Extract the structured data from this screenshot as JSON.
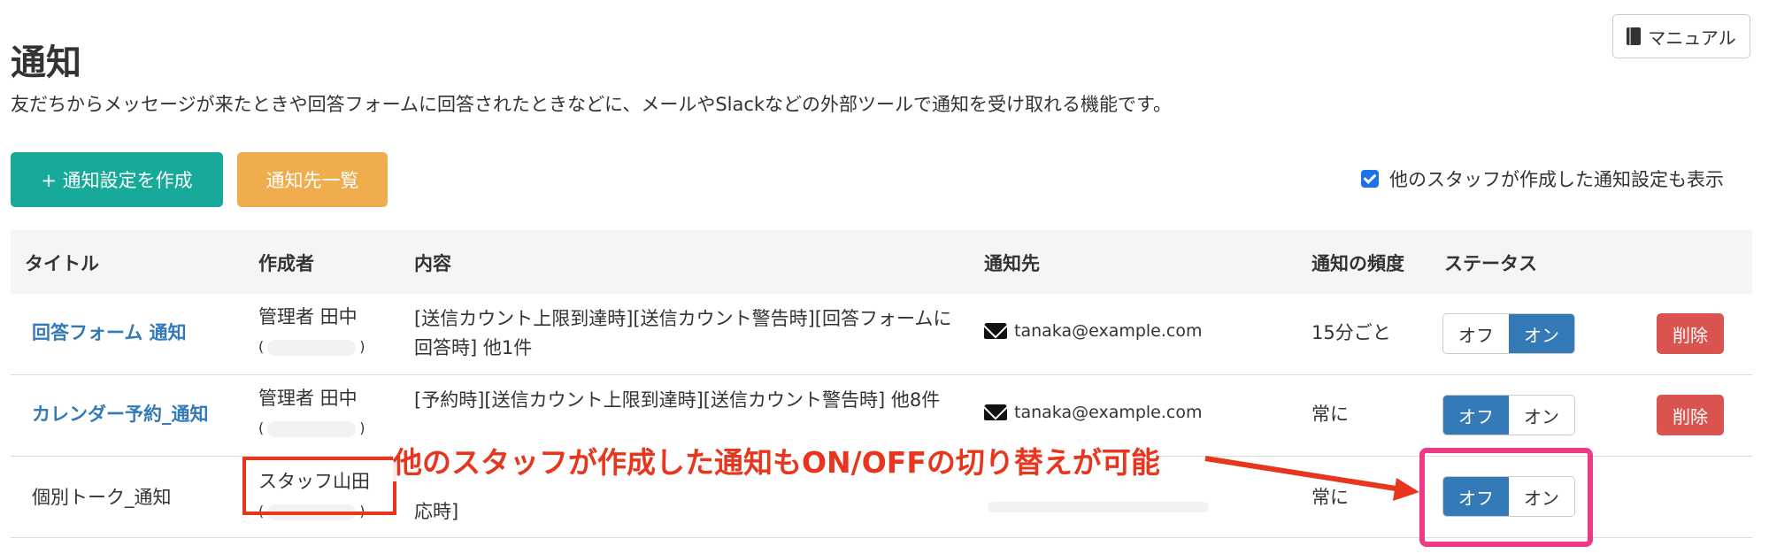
{
  "header": {
    "title": "通知",
    "description": "友だちからメッセージが来たときや回答フォームに回答されたときなどに、メールやSlackなどの外部ツールで通知を受け取れる機能です。",
    "manual_label": "マニュアル",
    "manual_icon": "book-icon"
  },
  "actions": {
    "create_label": "+ 通知設定を作成",
    "list_label": "通知先一覧",
    "show_others_label": "他のスタッフが作成した通知設定も表示",
    "show_others_checked": true
  },
  "table": {
    "columns": [
      "タイトル",
      "作成者",
      "内容",
      "通知先",
      "通知の頻度",
      "ステータス"
    ],
    "rows": [
      {
        "title": "回答フォーム 通知",
        "title_link": true,
        "creator": "管理者 田中",
        "creator_sub_open": "(",
        "creator_sub_close": ")",
        "content": "[送信カウント上限到達時][送信カウント警告時][回答フォームに回答時] 他1件",
        "destination": "tanaka@example.com",
        "frequency": "15分ごと",
        "off_label": "オフ",
        "on_label": "オン",
        "status": "on",
        "delete_label": "削除"
      },
      {
        "title": "カレンダー予約_通知",
        "title_link": true,
        "creator": "管理者 田中",
        "creator_sub_open": "(",
        "creator_sub_close": ")",
        "content": "[予約時][送信カウント上限到達時][送信カウント警告時] 他8件",
        "destination": "tanaka@example.com",
        "frequency": "常に",
        "off_label": "オフ",
        "on_label": "オン",
        "status": "off",
        "delete_label": "削除"
      },
      {
        "title": "個別トーク_通知",
        "title_link": false,
        "creator": "スタッフ山田",
        "creator_sub_open": "(",
        "creator_sub_close": ")",
        "content": "応時]",
        "destination": "",
        "frequency": "常に",
        "off_label": "オフ",
        "on_label": "オン",
        "status": "off"
      }
    ]
  },
  "annotation": {
    "text": "他のスタッフが作成した通知もON/OFFの切り替えが可能",
    "color": "#e8361e",
    "highlight_color": "#ec3a86"
  },
  "colors": {
    "primary": "#337ab7",
    "teal": "#17a99a",
    "orange": "#f0ad4e",
    "danger": "#d9534f"
  }
}
